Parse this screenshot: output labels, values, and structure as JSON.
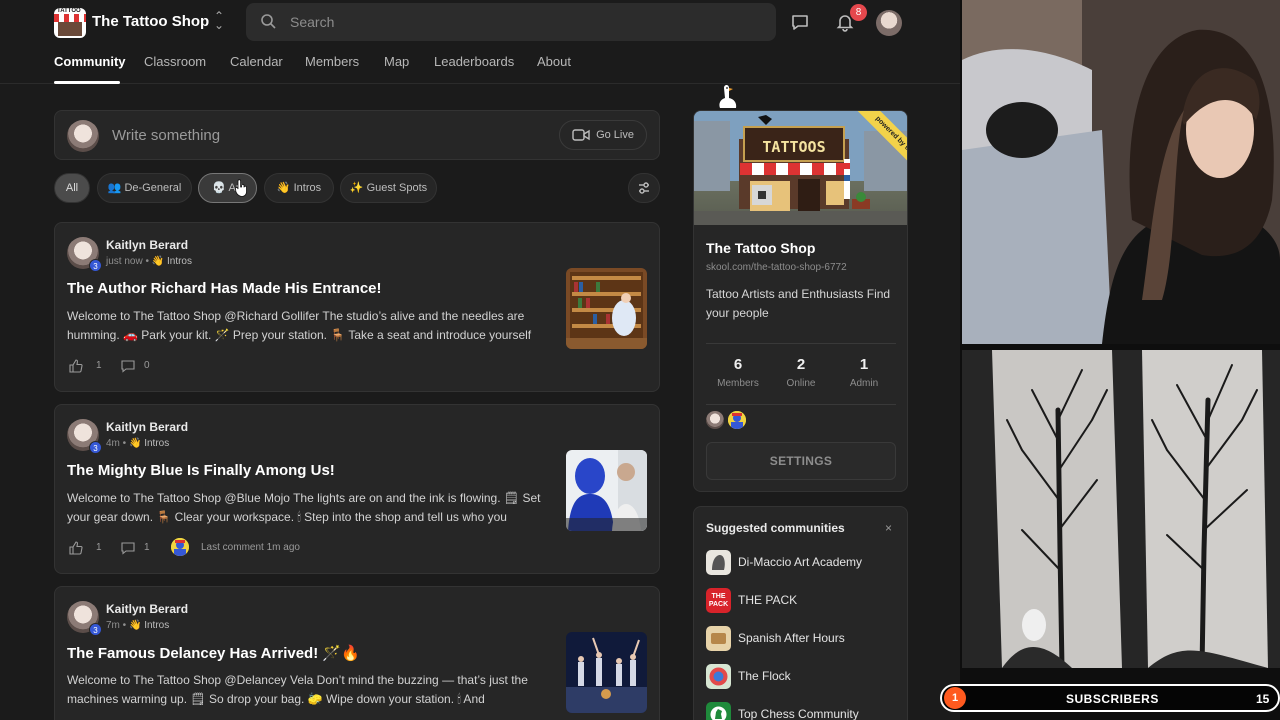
{
  "header": {
    "brand": "The Tattoo Shop",
    "logo_text": "TATTOO",
    "search_placeholder": "Search",
    "notifications_count": "8"
  },
  "nav": {
    "tabs": [
      "Community",
      "Classroom",
      "Calendar",
      "Members",
      "Map",
      "Leaderboards",
      "About"
    ],
    "active": "Community"
  },
  "composer": {
    "placeholder": "Write something",
    "golive_label": "Go Live"
  },
  "filters": {
    "all": "All",
    "degeneral": "👥 De-General",
    "art": "💀 Art",
    "intros": "👋 Intros",
    "guest": "✨ Guest Spots"
  },
  "posts": [
    {
      "author": "Kaitlyn Berard",
      "level": "3",
      "time": "just now",
      "category": "👋 Intros",
      "title": "The Author Richard Has Made His Entrance!",
      "body": "Welcome to The Tattoo Shop @Richard Gollifer The studio’s alive and the needles are humming. 🚗 Park your kit. 🪄 Prep your station. 🪑 Take a seat and introduce yourself",
      "likes": "1",
      "comments": "0",
      "last_comment": ""
    },
    {
      "author": "Kaitlyn Berard",
      "level": "3",
      "time": "4m",
      "category": "👋 Intros",
      "title": "The Mighty Blue Is Finally Among Us!",
      "body": "Welcome to The Tattoo Shop @Blue Mojo The lights are on and the ink is flowing. 🗒 Set your gear down. 🪑 Clear your workspace. 🕯 Step into the shop and tell us who you",
      "likes": "1",
      "comments": "1",
      "last_comment": "Last comment 1m ago"
    },
    {
      "author": "Kaitlyn Berard",
      "level": "3",
      "time": "7m",
      "category": "👋 Intros",
      "title": "The Famous Delancey Has Arrived! 🪄🔥",
      "body": "Welcome to The Tattoo Shop @Delancey Vela Don’t mind the buzzing — that’s just the machines warming up. 🗒 So drop your bag. 🧽 Wipe down your station. 🕯 And",
      "likes": "",
      "comments": "",
      "last_comment": ""
    }
  ],
  "group_card": {
    "image_sign": "TATTOOS",
    "ribbon": "powered by skool",
    "title": "The Tattoo Shop",
    "url": "skool.com/the-tattoo-shop-6772",
    "description": "Tattoo Artists and Enthusiasts Find your people",
    "stats": [
      {
        "num": "6",
        "label": "Members"
      },
      {
        "num": "2",
        "label": "Online"
      },
      {
        "num": "1",
        "label": "Admin"
      }
    ],
    "settings_label": "SETTINGS"
  },
  "suggested": {
    "title": "Suggested communities",
    "close": "×",
    "items": [
      {
        "name": "Di-Maccio Art Academy",
        "color": "#e9e6df"
      },
      {
        "name": "THE PACK",
        "color": "#d8232a",
        "badge": "THE PACK"
      },
      {
        "name": "Spanish After Hours",
        "color": "#e7d3a9"
      },
      {
        "name": "The Flock",
        "color": "#d7e6d3"
      },
      {
        "name": "Top Chess Community",
        "color": "#1f8a3b"
      }
    ]
  },
  "stream": {
    "subs_left": "1",
    "subs_label": "SUBSCRIBERS",
    "subs_right": "15"
  }
}
